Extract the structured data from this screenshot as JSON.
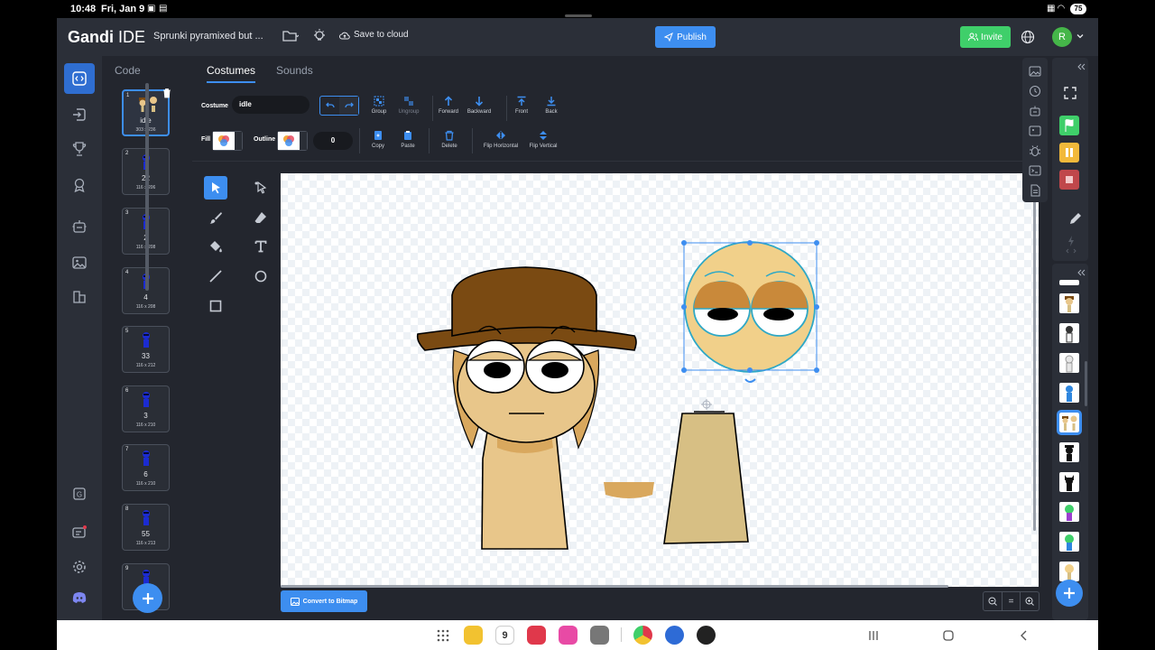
{
  "status_bar": {
    "time": "10:48",
    "date": "Fri, Jan 9",
    "battery": "75"
  },
  "header": {
    "logo_bold": "Gandi",
    "logo_light": "IDE",
    "project_title": "Sprunki pyramixed but ...",
    "save_to_cloud": "Save to cloud",
    "publish": "Publish",
    "invite": "Invite",
    "avatar_letter": "R"
  },
  "tabs": {
    "code": "Code",
    "costumes": "Costumes",
    "sounds": "Sounds"
  },
  "costumes": [
    {
      "num": "1",
      "name": "idle",
      "size": "303 x 236"
    },
    {
      "num": "2",
      "name": "22",
      "size": "116 x 206"
    },
    {
      "num": "3",
      "name": "2",
      "size": "116 x 208"
    },
    {
      "num": "4",
      "name": "4",
      "size": "116 x 208"
    },
    {
      "num": "5",
      "name": "33",
      "size": "116 x 212"
    },
    {
      "num": "6",
      "name": "3",
      "size": "116 x 210"
    },
    {
      "num": "7",
      "name": "6",
      "size": "116 x 210"
    },
    {
      "num": "8",
      "name": "55",
      "size": "116 x 213"
    },
    {
      "num": "9",
      "name": "",
      "size": ""
    }
  ],
  "editor": {
    "costume_label": "Costume",
    "costume_name": "idle",
    "fill_label": "Fill",
    "outline_label": "Outline",
    "outline_width": "0",
    "group": "Group",
    "ungroup": "Ungroup",
    "forward": "Forward",
    "backward": "Backward",
    "front": "Front",
    "back": "Back",
    "copy": "Copy",
    "paste": "Paste",
    "delete": "Delete",
    "flip_horizontal": "Flip Horizontal",
    "flip_vertical": "Flip Vertical",
    "convert_bitmap": "Convert to Bitmap",
    "zoom_reset": "="
  },
  "colors": {
    "accent": "#3d8ef0",
    "invite": "#3fcf6a",
    "hat": "#7a4a12",
    "skin": "#e8c68a",
    "skin_dark": "#d9a85e",
    "body": "#d7bf84",
    "eye_outline": "#2ea8c6"
  }
}
